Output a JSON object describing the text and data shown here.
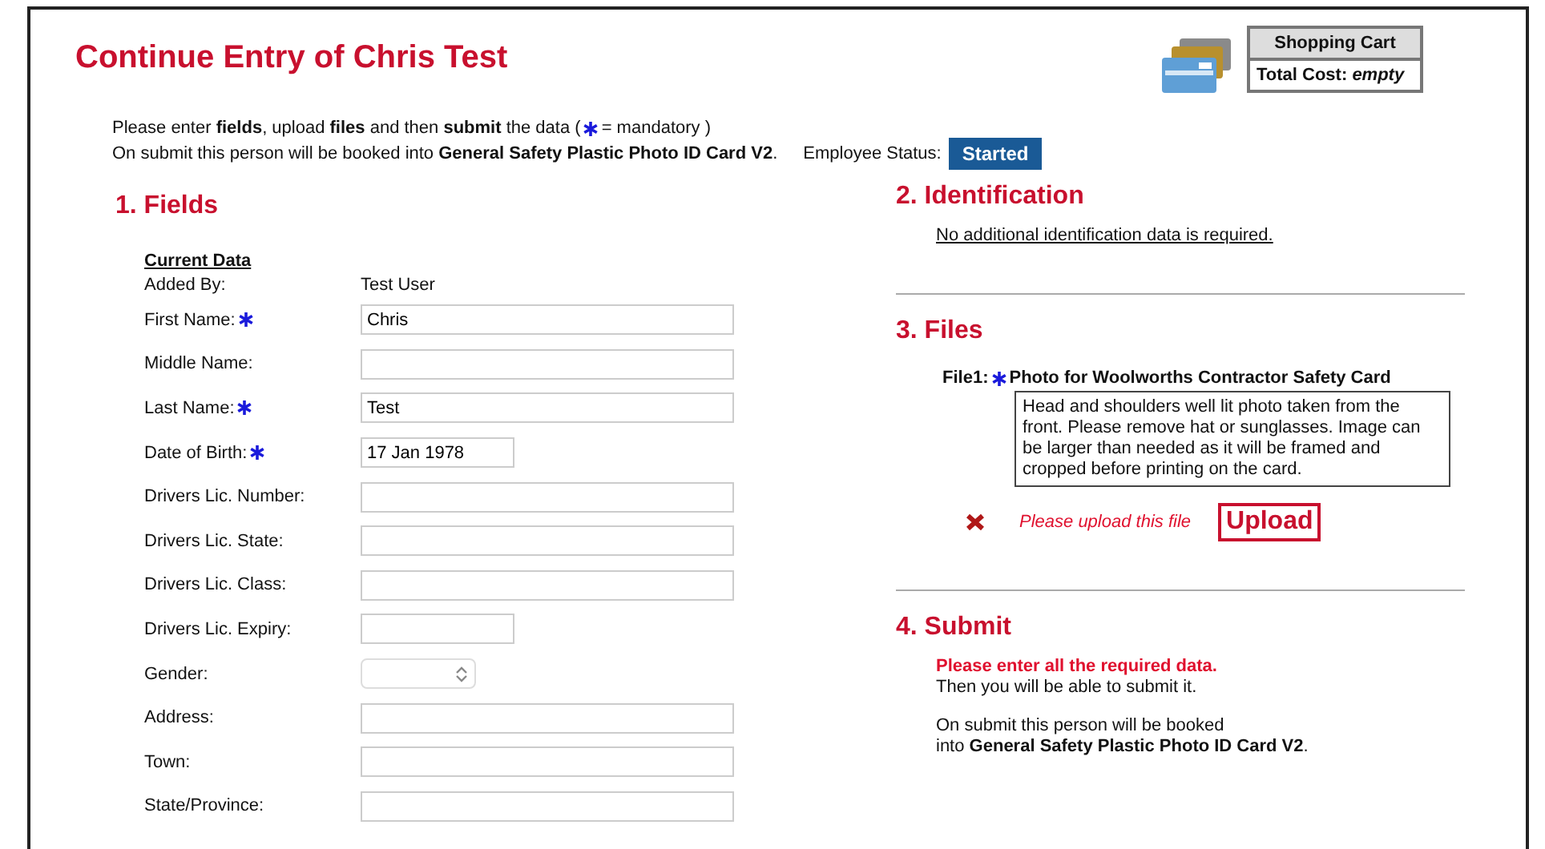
{
  "title": "Continue Entry of Chris Test",
  "cart": {
    "heading": "Shopping Cart",
    "cost_label": "Total Cost:",
    "cost_value": "empty"
  },
  "intro": {
    "line1_before": "Please enter **fields**, upload **files** and then **submit** the data  (",
    "line1_after": "= mandatory )",
    "line2": "On submit this person will be booked into **General Safety Plastic Photo ID Card V2**.",
    "status_label": "Employee Status:",
    "status": "Started"
  },
  "fields": {
    "heading": "1. Fields",
    "subheading": "Current Data",
    "rows": [
      {
        "kind": "static",
        "label": "Added By:",
        "mandatory": false,
        "value": "Test User"
      },
      {
        "kind": "text",
        "label": "First Name:",
        "mandatory": true,
        "value": "Chris"
      },
      {
        "kind": "text",
        "label": "Middle Name:",
        "mandatory": false
      },
      {
        "kind": "text",
        "label": "Last Name:",
        "mandatory": true,
        "value": "Test"
      },
      {
        "kind": "short",
        "label": "Date of Birth:",
        "mandatory": true,
        "value": "17 Jan 1978"
      },
      {
        "kind": "text",
        "label": "Drivers Lic. Number:",
        "mandatory": false
      },
      {
        "kind": "text",
        "label": "Drivers Lic. State:",
        "mandatory": false
      },
      {
        "kind": "text",
        "label": "Drivers Lic. Class:",
        "mandatory": false
      },
      {
        "kind": "short",
        "label": "Drivers Lic. Expiry:",
        "mandatory": false
      },
      {
        "kind": "select",
        "label": "Gender:",
        "mandatory": false
      },
      {
        "kind": "text",
        "label": "Address:",
        "mandatory": false
      },
      {
        "kind": "text",
        "label": "Town:",
        "mandatory": false
      },
      {
        "kind": "text",
        "label": "State/Province:",
        "mandatory": false
      }
    ]
  },
  "identification": {
    "heading": "2. Identification",
    "note": "No additional identification data is required."
  },
  "files": {
    "heading": "3. Files",
    "items": [
      {
        "label": "File1:",
        "mandatory": true,
        "title": "Photo for Woolworths Contractor Safety Card",
        "description": "Head and shoulders well lit photo taken from the front. Please remove hat or sunglasses. Image can be larger than needed as it will be framed and cropped before printing on the card.",
        "uploaded": false,
        "message": "Please upload this file",
        "button": "Upload"
      }
    ]
  },
  "submit": {
    "heading": "4. Submit",
    "warning": "Please enter all the required data.",
    "hint": "Then you will be able to submit it.",
    "info": "On submit this person will be booked\ninto **General Safety Plastic Photo ID Card V2**."
  }
}
